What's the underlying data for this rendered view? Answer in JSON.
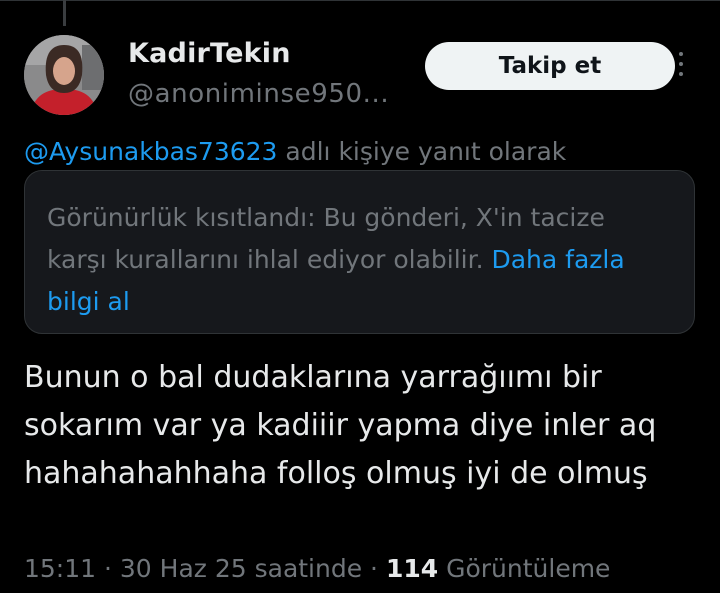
{
  "author": {
    "display_name": "KadirTekin",
    "handle": "@anoniminse950..."
  },
  "follow_button": {
    "label": "Takip et"
  },
  "more_menu": {
    "icon": "more-vertical-icon"
  },
  "reply_context": {
    "mention": "@Aysunakbas73623",
    "suffix": " adlı kişiye yanıt olarak"
  },
  "visibility_notice": {
    "text": "Görünürlük kısıtlandı: Bu gönderi, X'in tacize karşı kurallarını ihlal ediyor olabilir. ",
    "link": "Daha fazla bilgi al"
  },
  "tweet": {
    "text": "Bunun o bal dudaklarına yarrağıımı bir sokarım var ya kadiiir yapma diye inler aq hahahahahhaha folloş olmuş iyi de olmuş"
  },
  "meta": {
    "time": "15:11",
    "separator": " · ",
    "date": "30 Haz 25 saatinde",
    "view_count": "114",
    "view_label": " Görüntüleme"
  },
  "colors": {
    "background": "#000000",
    "text": "#e7e9ea",
    "secondary": "#71767b",
    "accent": "#1d9bf0",
    "button_bg": "#eff3f4"
  }
}
